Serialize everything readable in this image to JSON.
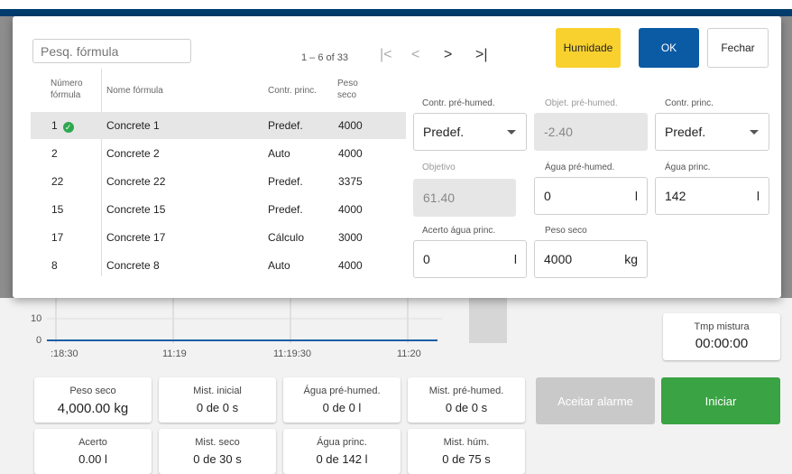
{
  "colors": {
    "humidity_button": "#f8d12e",
    "ok_button": "#0b5aa4",
    "start_button": "#3aa343",
    "status_ok": "#2ea84f",
    "header_bar": "#003d6e"
  },
  "dialog": {
    "search_placeholder": "Pesq. fórmula",
    "pager": {
      "range": "1 – 6 of 33",
      "first_icon": "first-page-icon",
      "prev_icon": "chevron-left-icon",
      "next_icon": "chevron-right-icon",
      "last_icon": "last-page-icon"
    },
    "buttons": {
      "humidity": "Humidade",
      "ok": "OK",
      "close": "Fechar"
    },
    "table": {
      "headers": {
        "number": "Número fórmula",
        "name": "Nome fórmula",
        "control": "Contr. princ.",
        "weight": "Peso seco"
      },
      "rows": [
        {
          "number": "1",
          "name": "Concrete 1",
          "control": "Predef.",
          "weight": "4000",
          "selected": true
        },
        {
          "number": "2",
          "name": "Concrete 2",
          "control": "Auto",
          "weight": "4000"
        },
        {
          "number": "22",
          "name": "Concrete 22",
          "control": "Predef.",
          "weight": "3375"
        },
        {
          "number": "15",
          "name": "Concrete 15",
          "control": "Predef.",
          "weight": "4000"
        },
        {
          "number": "17",
          "name": "Concrete 17",
          "control": "Cálculo",
          "weight": "3000"
        },
        {
          "number": "8",
          "name": "Concrete 8",
          "control": "Auto",
          "weight": "4000"
        }
      ]
    },
    "form": {
      "prehumid_control": {
        "label": "Contr. pré-humed.",
        "value": "Predef."
      },
      "prehumid_target": {
        "label": "Objet. pré-humed.",
        "value": "-2.40"
      },
      "main_control": {
        "label": "Contr. princ.",
        "value": "Predef."
      },
      "target": {
        "label": "Objetivo",
        "value": "61.40"
      },
      "prehumid_water": {
        "label": "Água pré-humed.",
        "value": "0",
        "unit": "l"
      },
      "main_water": {
        "label": "Água princ.",
        "value": "142",
        "unit": "l"
      },
      "main_water_adjust": {
        "label": "Acerto água princ.",
        "value": "0",
        "unit": "l"
      },
      "dry_weight": {
        "label": "Peso seco",
        "value": "4000",
        "unit": "kg"
      }
    }
  },
  "background": {
    "chart": {
      "y_ticks": [
        "10",
        "0"
      ],
      "x_ticks": [
        ":18:30",
        "11:19",
        "11:19:30",
        "11:20"
      ]
    },
    "mix_time": {
      "label": "Tmp mistura",
      "value": "00:00:00"
    },
    "cards": [
      {
        "label": "Peso seco",
        "value": "4,000.00 kg"
      },
      {
        "label": "Mist. inicial",
        "value": "0 de 0 s"
      },
      {
        "label": "Água pré-humed.",
        "value": "0 de 0 l"
      },
      {
        "label": "Mist. pré-humed.",
        "value": "0 de 0 s"
      },
      {
        "label": "Acerto",
        "value": "0.00 l"
      },
      {
        "label": "Mist. seco",
        "value": "0 de 30 s"
      },
      {
        "label": "Água princ.",
        "value": "0 de 142 l"
      },
      {
        "label": "Mist. húm.",
        "value": "0 de 75 s"
      }
    ],
    "accept_alarm": "Aceitar alarme",
    "start": "Iniciar"
  }
}
